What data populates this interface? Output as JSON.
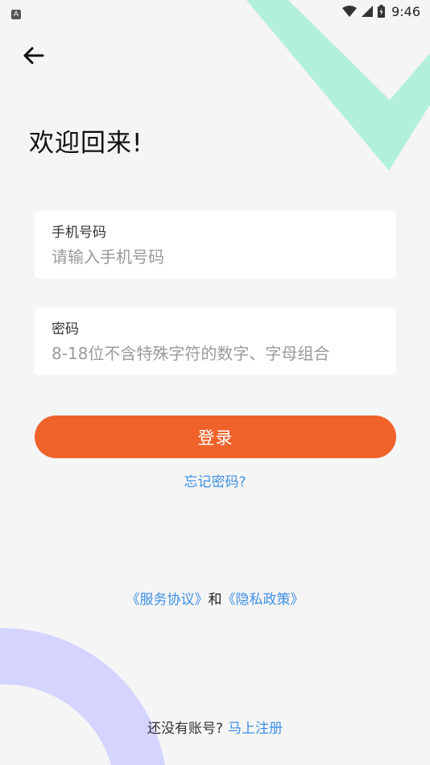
{
  "status_bar": {
    "time": "9:46",
    "app_icon_letter": "A"
  },
  "page": {
    "title": "欢迎回来!"
  },
  "form": {
    "phone": {
      "label": "手机号码",
      "placeholder": "请输入手机号码"
    },
    "password": {
      "label": "密码",
      "placeholder": "8-18位不含特殊字符的数字、字母组合"
    },
    "login_label": "登录",
    "forgot_label": "忘记密码?"
  },
  "agreement": {
    "service_label": "《服务协议》",
    "connector": "和",
    "privacy_label": "《隐私政策》"
  },
  "register": {
    "prompt": "还没有账号?",
    "link_label": "马上注册"
  },
  "colors": {
    "accent": "#ef632b",
    "link": "#3d8fe6",
    "deco_mint": "#b3f0dc",
    "deco_lavender": "#d5d3ff"
  },
  "icons": [
    "back-arrow-icon",
    "wifi-icon",
    "cellular-signal-icon",
    "battery-icon"
  ]
}
